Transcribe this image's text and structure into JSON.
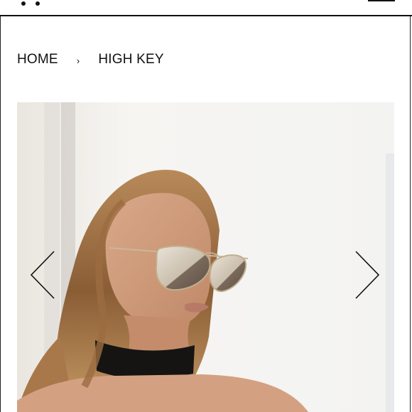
{
  "header": {
    "logo_icon": "dots-logo-icon",
    "menu_icon": "hamburger-menu-icon"
  },
  "breadcrumb": {
    "home_label": "HOME",
    "separator": "›",
    "current_label": "HIGH KEY"
  },
  "gallery": {
    "image_icon": "product-photo-model-aviator-sunglasses",
    "prev_icon": "chevron-left-icon",
    "next_icon": "chevron-right-icon"
  }
}
